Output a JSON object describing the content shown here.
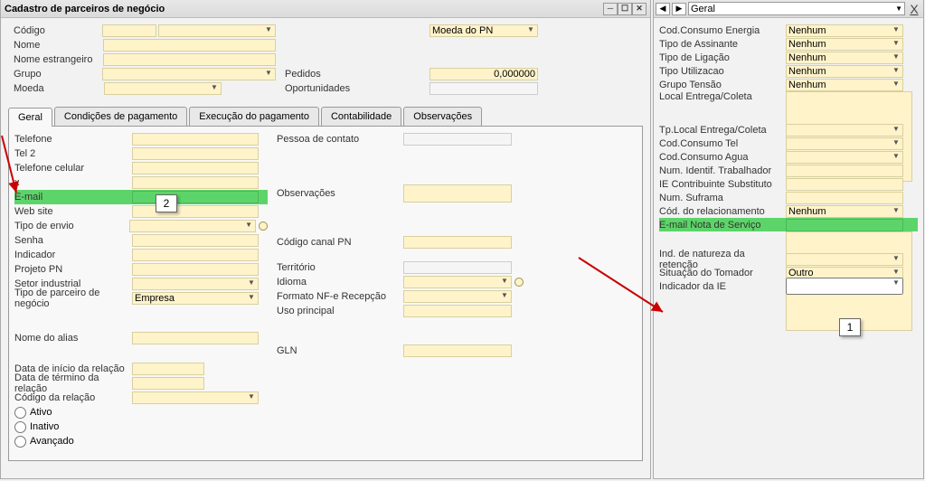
{
  "window": {
    "title": "Cadastro de parceiros de negócio"
  },
  "header": {
    "codigo": "Código",
    "nome": "Nome",
    "nome_estrangeiro": "Nome estrangeiro",
    "grupo": "Grupo",
    "moeda": "Moeda",
    "moeda_pn": "Moeda do PN",
    "pedidos": "Pedidos",
    "pedidos_value": "0,000000",
    "oportunidades": "Oportunidades"
  },
  "tabs": {
    "geral": "Geral",
    "condicoes": "Condições de pagamento",
    "execucao": "Execução do pagamento",
    "contabilidade": "Contabilidade",
    "observacoes": "Observações"
  },
  "geral": {
    "telefone": "Telefone",
    "tel2": "Tel 2",
    "tel_celular": "Telefone celular",
    "fax": "x",
    "email": "E-mail",
    "website": "Web site",
    "tipo_envio": "Tipo de envio",
    "senha": "Senha",
    "indicador": "Indicador",
    "projeto_pn": "Projeto PN",
    "setor_industrial": "Setor industrial",
    "tipo_parceiro": "Tipo de parceiro de negócio",
    "tipo_parceiro_value": "Empresa",
    "nome_alias": "Nome do alias",
    "data_inicio": "Data de início da relação",
    "data_termino": "Data de término da relação",
    "codigo_relacao": "Código da relação",
    "ativo": "Ativo",
    "inativo": "Inativo",
    "avancado": "Avançado",
    "pessoa_contato": "Pessoa de contato",
    "observacoes": "Observações",
    "codigo_canal": "Código canal PN",
    "territorio": "Território",
    "idioma": "Idioma",
    "formato_nfe": "Formato NF-e Recepção",
    "uso_principal": "Uso principal",
    "gln": "GLN"
  },
  "side": {
    "dropdown": "Geral",
    "cod_energia": "Cod.Consumo Energia",
    "tipo_assinante": "Tipo de Assinante",
    "tipo_ligacao": "Tipo de Ligação",
    "tipo_utilizacao": "Tipo Utilizacao",
    "grupo_tensao": "Grupo Tensão",
    "local_entrega": "Local Entrega/Coleta",
    "tp_local": "Tp.Local Entrega/Coleta",
    "cod_tel": "Cod.Consumo Tel",
    "cod_agua": "Cod.Consumo Agua",
    "num_ident": "Num. Identif. Trabalhador",
    "ie_contrib": "IE Contribuinte Substituto",
    "num_suframa": "Num. Suframa",
    "cod_relacionamento": "Cód. do relacionamento",
    "email_nota": "E-mail Nota de Serviço",
    "ind_natureza": "Ind. de natureza da retenção",
    "situacao_tomador": "Situação do Tomador",
    "indicador_ie": "Indicador da IE",
    "nenhum": "Nenhum",
    "outro": "Outro"
  },
  "callouts": {
    "c1": "1",
    "c2": "2"
  }
}
